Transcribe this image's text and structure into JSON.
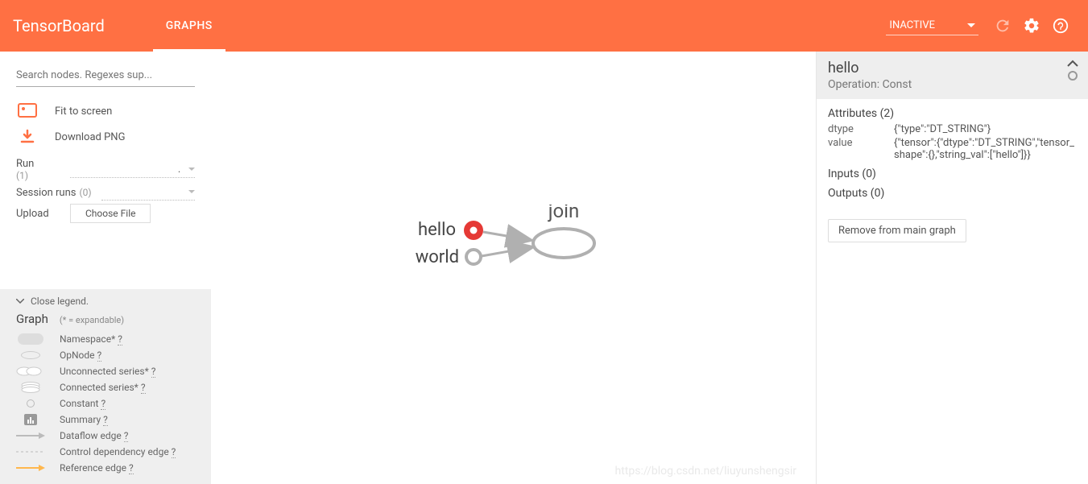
{
  "header": {
    "logo": "TensorBoard",
    "tab": "GRAPHS",
    "inactive_label": "INACTIVE"
  },
  "sidebar": {
    "search_placeholder": "Search nodes. Regexes sup...",
    "fit": "Fit to screen",
    "download": "Download PNG",
    "run_label": "Run",
    "run_count": "(1)",
    "session_label": "Session runs",
    "session_count": "(0)",
    "upload_label": "Upload",
    "choose_file": "Choose File"
  },
  "legend": {
    "close": "Close legend.",
    "title": "Graph",
    "hint": "(* = expandable)",
    "namespace": "Namespace*",
    "opnode": "OpNode",
    "unconnected": "Unconnected series*",
    "connected": "Connected series*",
    "constant": "Constant",
    "summary": "Summary",
    "dataflow": "Dataflow edge",
    "control": "Control dependency edge",
    "reference": "Reference edge",
    "q": "?"
  },
  "graph": {
    "node_hello": "hello",
    "node_world": "world",
    "node_join": "join"
  },
  "info": {
    "title": "hello",
    "operation": "Operation: Const",
    "attr_header": "Attributes (2)",
    "attr1_key": "dtype",
    "attr1_val": "{\"type\":\"DT_STRING\"}",
    "attr2_key": "value",
    "attr2_val": "{\"tensor\":{\"dtype\":\"DT_STRING\",\"tensor_shape\":{},\"string_val\":[\"hello\"]}}",
    "inputs": "Inputs (0)",
    "outputs": "Outputs (0)",
    "remove": "Remove from main graph"
  },
  "watermark": "https://blog.csdn.net/liuyunshengsir"
}
